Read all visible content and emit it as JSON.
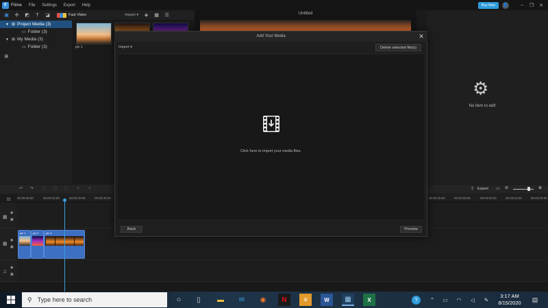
{
  "titlebar": {
    "app_name": "Filme",
    "menu": [
      "File",
      "Settings",
      "Export",
      "Help"
    ],
    "buy_now": "Buy Now",
    "minimize": "–",
    "restore": "❐",
    "close": "✕"
  },
  "toolbar": {
    "fast_video": "Fast Video",
    "import": "Import ▾"
  },
  "tree": {
    "items": [
      {
        "label": "Project Media (3)",
        "arrow": "▼"
      },
      {
        "label": "Folder (3)"
      },
      {
        "label": "My Media (3)",
        "arrow": "▼"
      },
      {
        "label": "Folder (3)"
      }
    ]
  },
  "media": {
    "items": [
      {
        "label": "pic 1"
      }
    ]
  },
  "preview": {
    "title": "Untitled"
  },
  "props": {
    "empty_text": "No item to edit"
  },
  "timeline": {
    "export": "Export",
    "ruler": [
      "00:00:00:00",
      "00:00:10:00",
      "00:00:20:00",
      "00:00:30:00",
      "00:02:40:00",
      "00:02:50:00",
      "00:03:00:00",
      "00:03:10:00",
      "00:03:20:00"
    ],
    "clips": [
      {
        "label": "pic 1"
      },
      {
        "label": "pic 2"
      },
      {
        "label": "pic 3"
      }
    ]
  },
  "dialog": {
    "title": "Add Your Media",
    "import": "Import ▾",
    "delete": "Delete selected file(s)",
    "hint": "Click here to import your media files.",
    "back": "Back",
    "preview": "Preview",
    "close": "✕"
  },
  "taskbar": {
    "search_placeholder": "Type here to search",
    "time": "3:17 AM",
    "date": "8/15/2020"
  }
}
